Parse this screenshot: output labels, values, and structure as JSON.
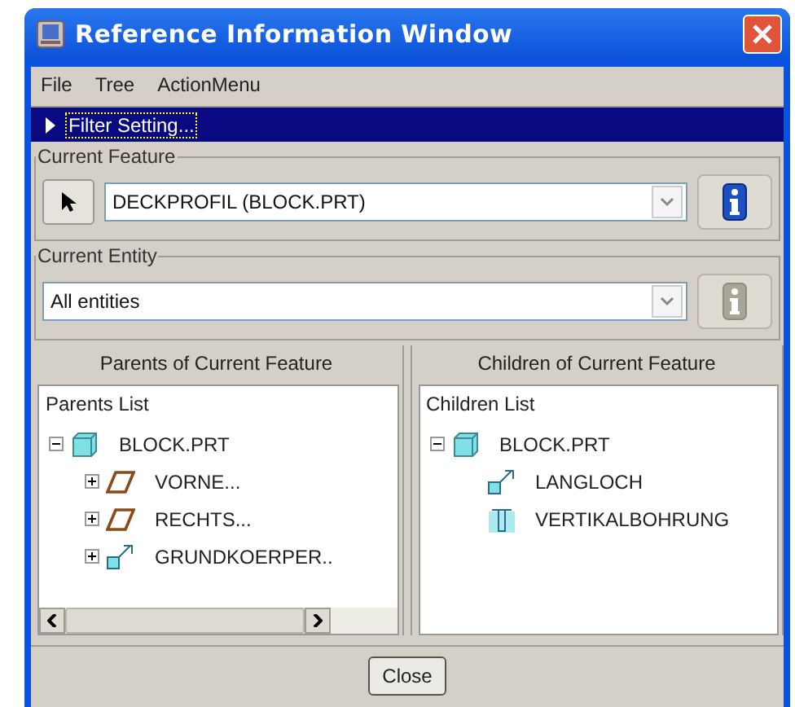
{
  "window": {
    "title": "Reference Information Window"
  },
  "menu": [
    "File",
    "Tree",
    "ActionMenu"
  ],
  "filter_bar": {
    "label": "Filter Setting...",
    "expanded": false
  },
  "current_feature": {
    "legend": "Current Feature",
    "value": "DECKPROFIL (BLOCK.PRT)",
    "info_disabled": false
  },
  "current_entity": {
    "legend": "Current Entity",
    "value": "All entities",
    "info_disabled": true
  },
  "parents_panel": {
    "heading": "Parents of Current Feature",
    "list_title": "Parents List",
    "tree": [
      {
        "label": "BLOCK.PRT",
        "kind": "part",
        "expanded": true,
        "children": [
          {
            "label": "VORNE...",
            "kind": "plane",
            "expanded": false
          },
          {
            "label": "RECHTS...",
            "kind": "plane",
            "expanded": false
          },
          {
            "label": "GRUNDKOERPER..",
            "kind": "extrude",
            "expanded": false
          }
        ]
      }
    ]
  },
  "children_panel": {
    "heading": "Children of Current Feature",
    "list_title": "Children List",
    "tree": [
      {
        "label": "BLOCK.PRT",
        "kind": "part",
        "expanded": true,
        "children": [
          {
            "label": "LANGLOCH",
            "kind": "extrude"
          },
          {
            "label": "VERTIKALBOHRUNG",
            "kind": "hole"
          }
        ]
      }
    ]
  },
  "buttons": [
    "Close"
  ]
}
